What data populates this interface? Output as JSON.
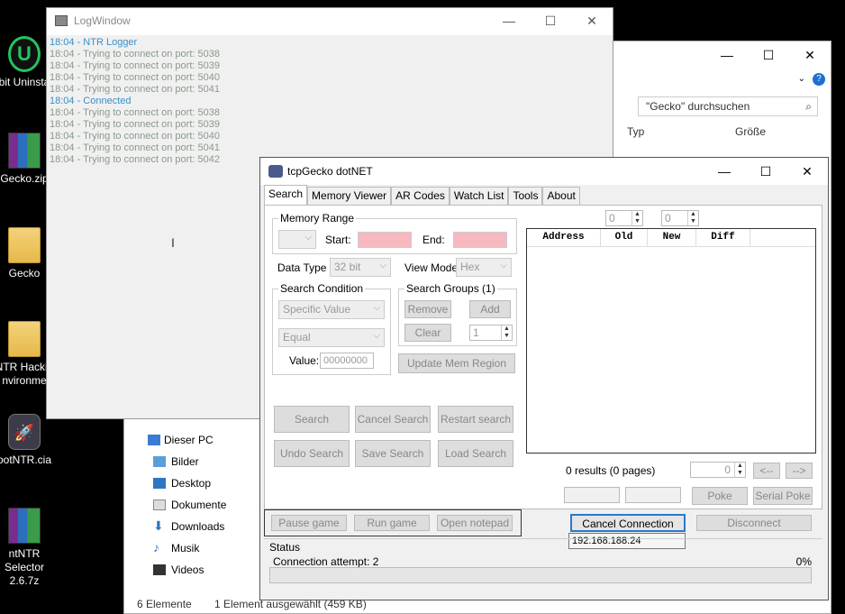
{
  "desktop": {
    "icons": [
      {
        "label": "bit Uninsta"
      },
      {
        "label": "Gecko.zip"
      },
      {
        "label": "Gecko"
      },
      {
        "label": "NTR Hackin\nnvironme"
      },
      {
        "label": "ootNTR.cia"
      },
      {
        "label": "ntNTR Selector\n2.6.7z"
      }
    ]
  },
  "explorer": {
    "search_placeholder": "\"Gecko\" durchsuchen",
    "col_type": "Typ",
    "col_size": "Größe",
    "nav": [
      {
        "label": "Dieser PC",
        "icon": "pc-icon"
      },
      {
        "label": "Bilder",
        "icon": "pictures-icon"
      },
      {
        "label": "Desktop",
        "icon": "desktop-icon"
      },
      {
        "label": "Dokumente",
        "icon": "documents-icon"
      },
      {
        "label": "Downloads",
        "icon": "downloads-icon"
      },
      {
        "label": "Musik",
        "icon": "music-icon"
      },
      {
        "label": "Videos",
        "icon": "videos-icon"
      }
    ],
    "status_count": "6 Elemente",
    "status_selected": "1 Element ausgewählt (459 KB)"
  },
  "logwindow": {
    "title": "LogWindow",
    "lines": [
      {
        "text": "18:04 - NTR Logger",
        "color": "#3a8fc7"
      },
      {
        "text": "18:04 - Trying to connect on port: 5038",
        "color": "#8a9a8a"
      },
      {
        "text": "18:04 - Trying to connect on port: 5039",
        "color": "#8a9a8a"
      },
      {
        "text": "18:04 - Trying to connect on port: 5040",
        "color": "#8a9a8a"
      },
      {
        "text": "18:04 - Trying to connect on port: 5041",
        "color": "#8a9a8a"
      },
      {
        "text": "18:04 - Connected",
        "color": "#3a8fc7"
      },
      {
        "text": "18:04 - Trying to connect on port: 5038",
        "color": "#8a9a8a"
      },
      {
        "text": "18:04 - Trying to connect on port: 5039",
        "color": "#8a9a8a"
      },
      {
        "text": "18:04 - Trying to connect on port: 5040",
        "color": "#8a9a8a"
      },
      {
        "text": "18:04 - Trying to connect on port: 5041",
        "color": "#8a9a8a"
      },
      {
        "text": "18:04 - Trying to connect on port: 5042",
        "color": "#8a9a8a"
      }
    ]
  },
  "gecko": {
    "title": "tcpGecko dotNET",
    "tabs": [
      "Search",
      "Memory Viewer",
      "AR Codes",
      "Watch List",
      "Tools",
      "About"
    ],
    "memory_range": "Memory Range",
    "start_label": "Start:",
    "end_label": "End:",
    "data_type_label": "Data Type",
    "data_type_value": "32 bit",
    "view_mode_label": "View Mode",
    "view_mode_value": "Hex",
    "search_condition": "Search Condition",
    "condition_value": "Specific Value",
    "compare_value": "Equal",
    "value_label": "Value:",
    "value_input": "00000000",
    "search_groups": "Search Groups (1)",
    "remove": "Remove",
    "add": "Add",
    "clear": "Clear",
    "group_num": "1",
    "update_mem": "Update Mem Region",
    "search": "Search",
    "cancel_search": "Cancel Search",
    "restart_search": "Restart search",
    "undo_search": "Undo Search",
    "save_search": "Save Search",
    "load_search": "Load Search",
    "spin_a": "0",
    "spin_b": "0",
    "columns": [
      "Address",
      "Old",
      "New",
      "Diff"
    ],
    "results": "0 results (0 pages)",
    "page_spin": "0",
    "prev": "<--",
    "next": "-->",
    "poke": "Poke",
    "serial_poke": "Serial Poke",
    "pause_game": "Pause game",
    "run_game": "Run game",
    "open_notepad": "Open notepad",
    "cancel_connection": "Cancel Connection",
    "disconnect": "Disconnect",
    "ip": "192.168.188.24",
    "status_label": "Status",
    "status_text": "Connection attempt: 2",
    "percent": "0%"
  }
}
